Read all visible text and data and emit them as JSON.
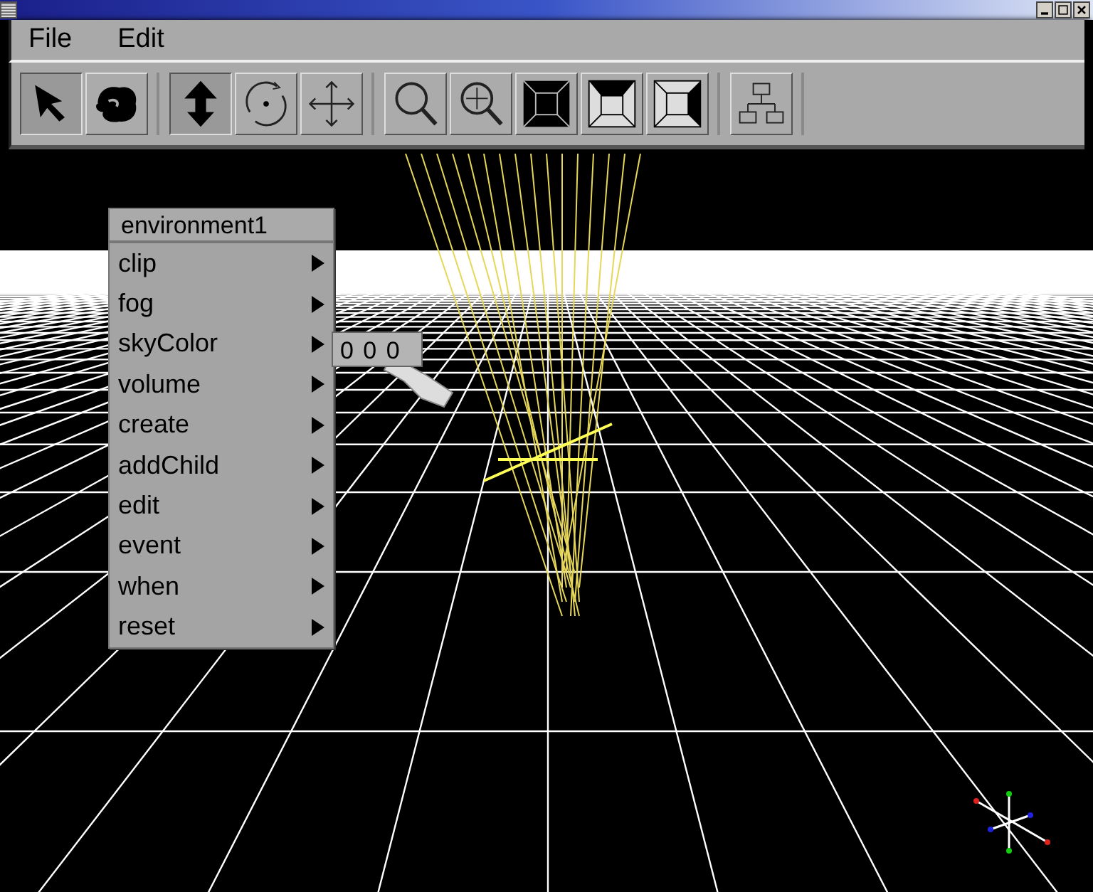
{
  "menubar": [
    "File",
    "Edit"
  ],
  "toolbar": [
    [
      {
        "kind": "select",
        "selected": true
      },
      {
        "kind": "grab",
        "selected": false
      }
    ],
    [
      {
        "kind": "lift",
        "selected": true
      },
      {
        "kind": "rotate",
        "selected": false
      },
      {
        "kind": "move",
        "selected": false
      }
    ],
    [
      {
        "kind": "zoom",
        "selected": false
      },
      {
        "kind": "zoom-move",
        "selected": false
      },
      {
        "kind": "view-front",
        "selected": false
      },
      {
        "kind": "view-top",
        "selected": false
      },
      {
        "kind": "view-side",
        "selected": false
      }
    ],
    [
      {
        "kind": "hierarchy",
        "selected": false
      }
    ]
  ],
  "context_menu": {
    "title": "environment1",
    "items": [
      {
        "label": "clip"
      },
      {
        "label": "fog"
      },
      {
        "label": "skyColor"
      },
      {
        "label": "volume"
      },
      {
        "label": "create"
      },
      {
        "label": "addChild"
      },
      {
        "label": "edit"
      },
      {
        "label": "event"
      },
      {
        "label": "when"
      },
      {
        "label": "reset"
      }
    ]
  },
  "value_field": {
    "value": "0 0 0"
  }
}
